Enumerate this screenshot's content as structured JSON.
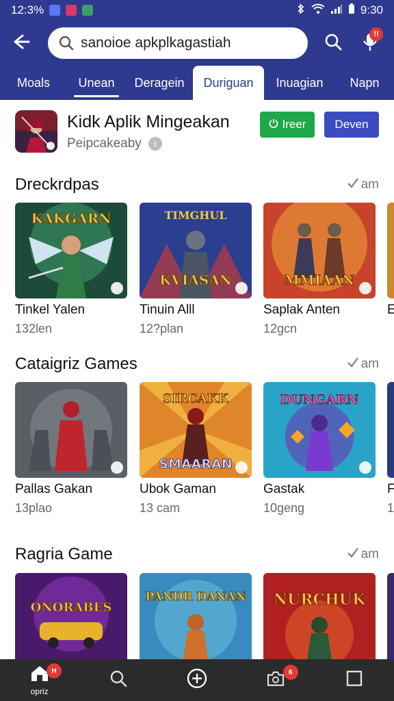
{
  "status_bar": {
    "time_left": "12:3%",
    "time_right": "9:30"
  },
  "search": {
    "query": "sanoioe apkplkagastiah"
  },
  "header_actions": {
    "mic_badge": "!!"
  },
  "tabs": [
    {
      "label": "Moals"
    },
    {
      "label": "Unean"
    },
    {
      "label": "Deragein"
    },
    {
      "label": "Duriguan"
    },
    {
      "label": "Inuagian"
    },
    {
      "label": "Napn"
    }
  ],
  "app": {
    "title": "Kidk Aplik Mingeakan",
    "subtitle": "Peipcakeaby",
    "green_button": "Ireer",
    "blue_button": "Deven"
  },
  "sections": [
    {
      "title": "Dreckrdpas",
      "more": "am",
      "cards": [
        {
          "title": "Tinkel Yalen",
          "sub": "132len",
          "banner": "KAKGARN"
        },
        {
          "title": "Tinuin Alll",
          "sub": "12?plan",
          "banner": "KVIASAN"
        },
        {
          "title": "Saplak Anten",
          "sub": "12gcn",
          "banner": "MMIAAN"
        },
        {
          "title": "E",
          "sub": ""
        }
      ]
    },
    {
      "title": "Cataigriz Games",
      "more": "am",
      "cards": [
        {
          "title": "Pallas Gakan",
          "sub": "13plao",
          "banner": ""
        },
        {
          "title": "Ubok Gaman",
          "sub": "13 cam",
          "banner": "SMAARAN"
        },
        {
          "title": "Gastak",
          "sub": "10geng",
          "banner": "DUNGARN"
        },
        {
          "title": "F",
          "sub": "1"
        }
      ]
    },
    {
      "title": "Ragria Game",
      "more": "am",
      "cards": [
        {
          "title": "",
          "sub": "",
          "banner": "ONORABES"
        },
        {
          "title": "",
          "sub": "",
          "banner": "PANDR DANAN"
        },
        {
          "title": "",
          "sub": "",
          "banner": "NURCHUK"
        },
        {
          "title": "",
          "sub": ""
        }
      ]
    }
  ],
  "bottom_nav": [
    {
      "label": "opriz",
      "icon": "home-icon",
      "badge": "H"
    },
    {
      "label": "",
      "icon": "search-icon",
      "badge": ""
    },
    {
      "label": "",
      "icon": "add-circle-icon",
      "badge": ""
    },
    {
      "label": "",
      "icon": "camera-icon",
      "badge": "6"
    },
    {
      "label": "",
      "icon": "square-icon",
      "badge": ""
    }
  ],
  "colors": {
    "brand": "#2e3a8f",
    "green": "#1ea84a",
    "blue_button": "#3b4cc0",
    "badge": "#e53935",
    "nav_bg": "#2b2b2b"
  }
}
